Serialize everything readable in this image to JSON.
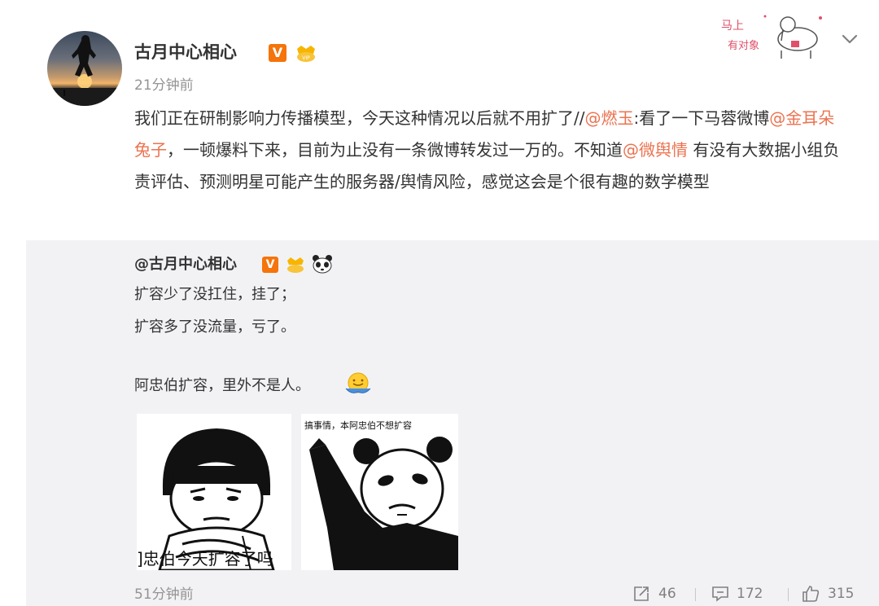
{
  "post": {
    "username": "古月中心相心",
    "vbadge": "V",
    "timestamp": "21分钟前",
    "text": [
      {
        "t": "我们正在研制影响力传播模型，今天这种情况以后就不用扩了//",
        "m": false
      },
      {
        "t": "@燃玉",
        "m": true
      },
      {
        "t": ":看了一下马蓉微博",
        "m": false
      },
      {
        "t": "@金耳朵兔子",
        "m": true
      },
      {
        "t": "，一顿爆料下来，目前为止没有一条微博转发过一万的。不知道",
        "m": false
      },
      {
        "t": "@微舆情",
        "m": true
      },
      {
        "t": " 有没有大数据小组负责评估、预测明星可能产生的服务器/舆情风险，感觉这会是个很有趣的数学模型",
        "m": false
      }
    ],
    "sticker_text": [
      "马上",
      "有对象"
    ]
  },
  "repost": {
    "username": "@古月中心相心",
    "vbadge": "V",
    "lines": [
      "扩容少了没扛住，挂了；",
      "扩容多了没流量，亏了。",
      "阿忠伯扩容，里外不是人。"
    ],
    "image1_caption": "]忠伯今天扩容了吗",
    "image2_caption": "搞事情，本阿忠伯不想扩容",
    "timestamp": "51分钟前",
    "actions": {
      "forward_count": "46",
      "comment_count": "172",
      "like_count": "315"
    }
  },
  "colors": {
    "mention": "#eb7350",
    "vbadge": "#f5740b",
    "repost_bg": "#f2f2f5",
    "meta": "#939393"
  },
  "icons": [
    "vip-crown-icon",
    "chevron-down-icon",
    "panda-icon",
    "hug-emoji-icon",
    "forward-icon",
    "comment-icon",
    "like-icon"
  ]
}
